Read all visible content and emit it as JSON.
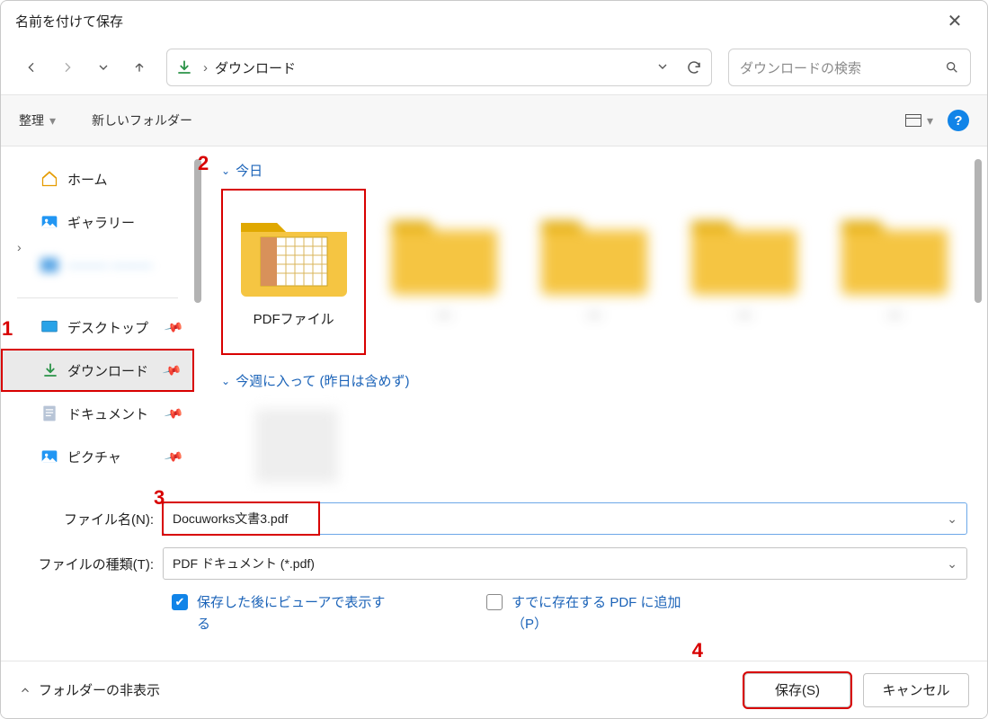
{
  "title": "名前を付けて保存",
  "address": {
    "location": "ダウンロード"
  },
  "search": {
    "placeholder": "ダウンロードの検索"
  },
  "toolbar": {
    "organize": "整理",
    "new_folder": "新しいフォルダー"
  },
  "sidebar": {
    "home": "ホーム",
    "gallery": "ギャラリー",
    "blurred": "———  ———",
    "desktop": "デスクトップ",
    "downloads": "ダウンロード",
    "documents": "ドキュメント",
    "pictures": "ピクチャ"
  },
  "groups": {
    "today": "今日",
    "this_week": "今週に入って (昨日は含めず)"
  },
  "files": {
    "pdf_folder": "PDFファイル"
  },
  "fields": {
    "filename_label": "ファイル名(N):",
    "filename_value": "Docuworks文書3.pdf",
    "filetype_label": "ファイルの種類(T):",
    "filetype_value": "PDF ドキュメント (*.pdf)"
  },
  "checks": {
    "open_after": "保存した後にビューアで表示する",
    "append_existing": "すでに存在する PDF に追加（P）"
  },
  "footer": {
    "hide_folders": "フォルダーの非表示",
    "save": "保存(S)",
    "cancel": "キャンセル"
  },
  "annotations": {
    "a1": "1",
    "a2": "2",
    "a3": "3",
    "a4": "4"
  }
}
